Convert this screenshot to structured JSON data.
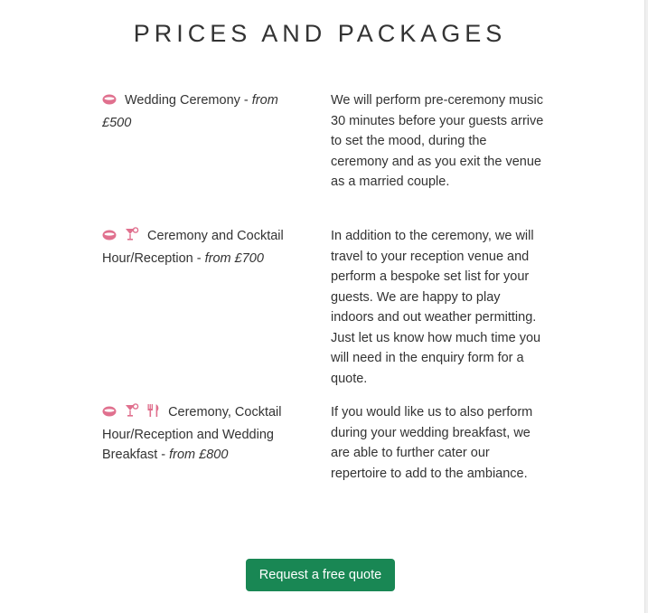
{
  "heading": "PRICES AND PACKAGES",
  "colors": {
    "icon_pink": "#e0708e",
    "button_green": "#198754",
    "text": "#333333"
  },
  "packages": [
    {
      "icons": [
        "ring-icon"
      ],
      "name": "Wedding Ceremony - ",
      "price": "from £500",
      "description": "We will perform pre-ceremony music 30 minutes before your guests arrive to set the mood, during the ceremony and as you exit the venue as a married couple."
    },
    {
      "icons": [
        "ring-icon",
        "cocktail-icon"
      ],
      "name": "Ceremony and Cocktail Hour/Reception - ",
      "price": "from £700",
      "description": "In addition to the ceremony, we will travel to your reception venue and perform a bespoke set list for your guests. We are happy to play indoors and out weather permitting. Just let us know how much time you will need in the enquiry form for a quote."
    },
    {
      "icons": [
        "ring-icon",
        "cocktail-icon",
        "utensils-icon"
      ],
      "name": "Ceremony, Cocktail Hour/Reception and Wedding Breakfast - ",
      "price": "from £800",
      "description": "If you would like us to also perform during your wedding breakfast, we are able to further cater our repertoire to add to the ambiance."
    }
  ],
  "cta": {
    "label": "Request a free quote"
  }
}
